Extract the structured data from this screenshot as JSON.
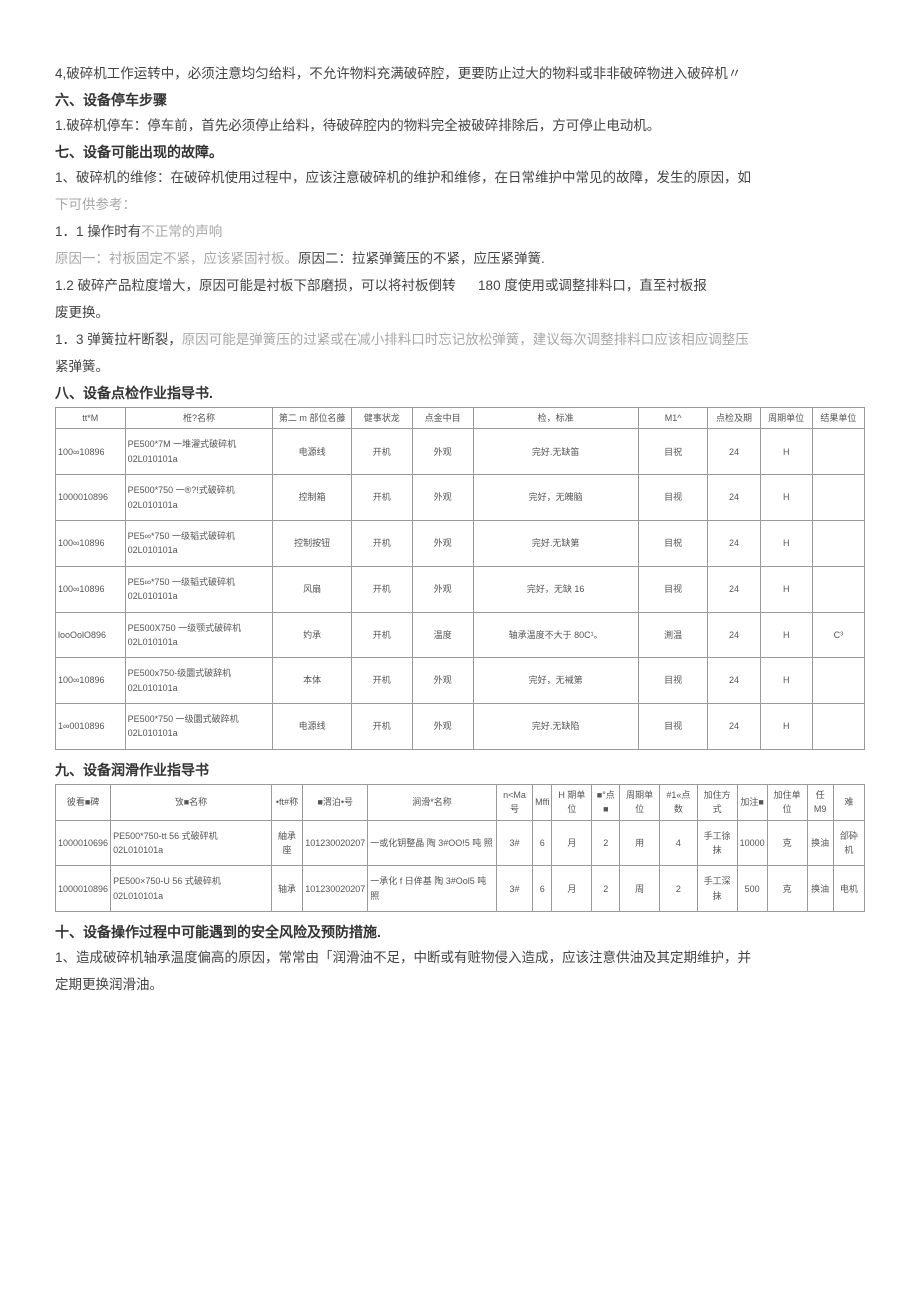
{
  "p1": "4,破碎机工作运转中，必须注意均匀给料，不允许物料充满破碎腔，更要防止过大的物料或非非破碎物进入破碎机〃",
  "h6": "六、设备停车步骤",
  "p2": "1.破碎机停车：停车前，首先必须停止给料，待破碎腔内的物料完全被破碎排除后，方可停止电动机。",
  "h7": "七、设备可能出现的故障。",
  "p3a": "1、破碎机的维修：在破碎机使用过程中，应该注意破碎机的维护和维修，在日常维护中常见的故障，发生的原因，如",
  "p3b": "下可供参考：",
  "p4a": "1．1 操作时有",
  "p4b": "不正常的声响",
  "p5a": "原因一：衬板固定不紧，应该紧固衬板。",
  "p5b": "原因二：拉紧弹簧压的不紧，应压紧弹簧.",
  "p6a": "1.2 破碎产品粒度增大，原因可能是衬板下部磨损，可以将衬板倒转",
  "p6b": "180 度使用或调整排料口，直至衬板报",
  "p6c": "废更换。",
  "p7a": "1．3 弹簧拉杆断裂，",
  "p7b": "原因可能是弹簧压的过紧或在减小排料口时忘记放松弹簧，建议每次调整排料口应该相应调整压",
  "p7c": "紧弹簧。",
  "h8": "八、设备点检作业指导书.",
  "t1": {
    "head": [
      "tt*M",
      "栣?名称",
      "第二 m 部位名藤",
      "健事状龙",
      "点金中目",
      "检，标准",
      "M1^",
      "点检及期",
      "周期单位",
      "结果单位"
    ],
    "rows": [
      [
        "100∞10896",
        "PE500*7M 一堆濯式破碎机 02L010101a",
        "电源线",
        "开机",
        "外观",
        "完好.无缺笛",
        "目祝",
        "24",
        "H",
        ""
      ],
      [
        "1000010896",
        "PE500*750 一®?!式破碎机 02L010101a",
        "控制箱",
        "开机",
        "外观",
        "完好，无魄脑",
        "目视",
        "24",
        "H",
        ""
      ],
      [
        "100∞10896",
        "PE5∞*750 一级韬式破碎机 02L010101a",
        "控制按钮",
        "开机",
        "外观",
        "完好.无缺第",
        "目柷",
        "24",
        "H",
        ""
      ],
      [
        "100∞10896",
        "PE5∞*750 一级韬式破碎机 02L010101a",
        "风扇",
        "开机",
        "外观",
        "完好，无缺 16",
        "目视",
        "24",
        "H",
        ""
      ],
      [
        "looOolO896",
        "PE500X750 一级颚式破碎机 02L010101a",
        "妁承",
        "开机",
        "温度",
        "轴承温度不大于 80C¹。",
        "渆温",
        "24",
        "H",
        "C³"
      ],
      [
        "100∞10896",
        "PE500x750-级圜式破辞机 02L010101a",
        "本体",
        "开机",
        "外观",
        "完好，无裓第",
        "目视",
        "24",
        "H",
        ""
      ],
      [
        "1∞0010896",
        "PE500*750 一级圜式破踤机 02L010101a",
        "电源线",
        "开机",
        "外观",
        "完好.无缺陷",
        "目视",
        "24",
        "H",
        ""
      ]
    ]
  },
  "h9": "九、设备润滑作业指导书",
  "t2": {
    "head": [
      "彼看■碑",
      "攷■名称",
      "•ft#称",
      "■渭泊•号",
      "涧滑*名称",
      "n<Ma号",
      "Mffi",
      "H 期单位",
      "■°点■",
      "周期单位",
      "#1«点数",
      "加住方式",
      "加注■",
      "加住单位",
      "任M9",
      "难"
    ],
    "rows": [
      [
        "1000010696",
        "PE500*750-tt 56 式破砰机 02L010101a",
        "紬承座",
        "101230020207",
        "一或化钥整晶 陶 3#OO!5 吨 照",
        "3#",
        "6",
        "月",
        "2",
        "用",
        "4",
        "手工徐抹",
        "10000",
        "克",
        "换油",
        "郃砕机"
      ],
      [
        "1000010896",
        "PE500×750-U 56 式破碎机 02L010101a",
        "轴承",
        "101230020207",
        "一承化 f 日侔基 陶 3#Ool5 吨 照",
        "3#",
        "6",
        "月",
        "2",
        "周",
        "2",
        "手工深抹",
        "500",
        "克",
        "换油",
        "电机"
      ]
    ]
  },
  "h10": "十、设备操作过程中可能遇到的安全风险及预防措施.",
  "p8": "1、造成破碎机轴承温度偏高的原因，常常由「润滑油不足，中断或有赃物侵入造成，应该注意供油及其定期维护，并",
  "p9": "定期更换润滑油。"
}
